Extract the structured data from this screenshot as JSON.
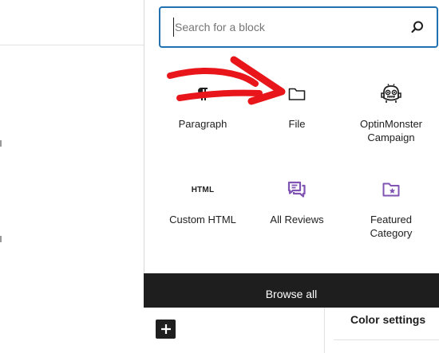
{
  "search": {
    "placeholder": "Search for a block"
  },
  "blocks": [
    {
      "label": "Paragraph",
      "icon": "paragraph-icon"
    },
    {
      "label": "File",
      "icon": "folder-icon"
    },
    {
      "label": "OptinMonster\nCampaign",
      "icon": "optinmonster-icon"
    },
    {
      "label": "Custom HTML",
      "icon": "html-icon",
      "glyph": "HTML"
    },
    {
      "label": "All Reviews",
      "icon": "reviews-icon"
    },
    {
      "label": "Featured\nCategory",
      "icon": "featured-category-icon"
    }
  ],
  "browse_all": {
    "label": "Browse all"
  },
  "settings": {
    "color_settings_label": "Color settings"
  },
  "colors": {
    "accent": "#2271b1",
    "dark": "#1e1e1e",
    "purple_icon": "#7f54b3",
    "annotation_red": "#e8161a"
  }
}
